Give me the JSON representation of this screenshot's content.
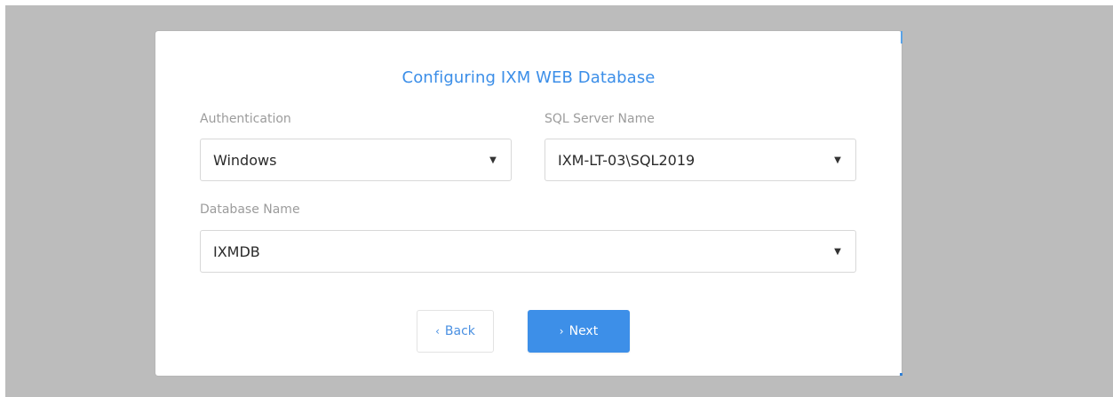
{
  "dialog": {
    "title": "Configuring IXM WEB Database"
  },
  "authentication": {
    "label": "Authentication",
    "value": "Windows"
  },
  "sql_server": {
    "label": "SQL Server Name",
    "value": "IXM-LT-03\\SQL2019"
  },
  "database": {
    "label": "Database Name",
    "value": "IXMDB"
  },
  "buttons": {
    "back_glyph": "‹",
    "back_label": "Back",
    "next_glyph": "›",
    "next_label": "Next"
  },
  "icons": {
    "dropdown": "▼"
  },
  "colors": {
    "accent": "#3d8fe8",
    "backdrop": "#bcbcbc"
  }
}
